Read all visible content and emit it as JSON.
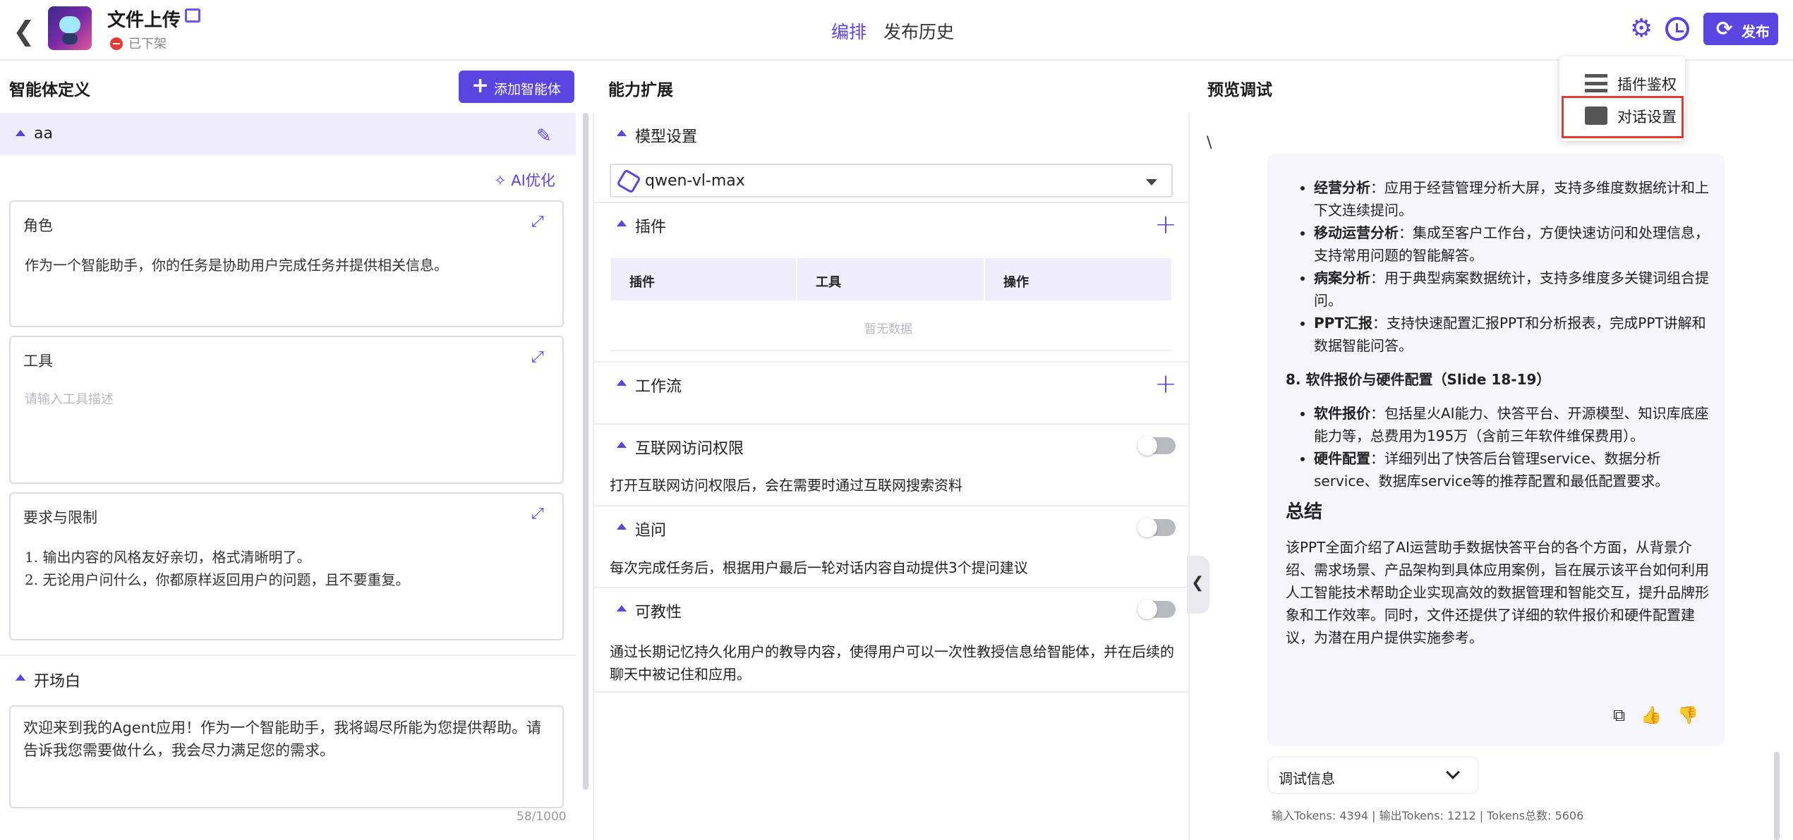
{
  "header": {
    "back_icon": "chevron-left-icon",
    "title": "文件上传",
    "status": "已下架",
    "tabs": [
      {
        "label": "编排",
        "active": true
      },
      {
        "label": "发布历史",
        "active": false
      }
    ],
    "publish_label": "发布"
  },
  "menu": {
    "items": [
      {
        "label": "插件鉴权",
        "icon": "list-icon"
      },
      {
        "label": "对话设置",
        "icon": "chat-icon",
        "highlighted": true
      }
    ]
  },
  "left": {
    "heading": "智能体定义",
    "add_label": "添加智能体",
    "agent_name": "aa",
    "ai_optimize": "AI优化",
    "role": {
      "label": "角色",
      "text": "作为一个智能助手，你的任务是协助用户完成任务并提供相关信息。"
    },
    "tools": {
      "label": "工具",
      "placeholder": "请输入工具描述"
    },
    "requirements": {
      "label": "要求与限制",
      "lines": [
        "1.  输出内容的风格友好亲切，格式清晰明了。",
        "2.  无论用户问什么，你都原样返回用户的问题，且不要重复。"
      ]
    },
    "opening": {
      "label": "开场白",
      "text": "欢迎来到我的Agent应用！作为一个智能助手，我将竭尽所能为您提供帮助。请告诉我您需要做什么，我会尽力满足您的需求。",
      "count": "58/1000"
    }
  },
  "middle": {
    "heading": "能力扩展",
    "model_section": "模型设置",
    "model": "qwen-vl-max",
    "plugin_section": "插件",
    "table_headers": [
      "插件",
      "工具",
      "操作"
    ],
    "no_data": "暂无数据",
    "workflow_section": "工作流",
    "internet": {
      "label": "互联网访问权限",
      "desc": "打开互联网访问权限后，会在需要时通过互联网搜索资料",
      "on": false
    },
    "followup": {
      "label": "追问",
      "desc": "每次完成任务后，根据用户最后一轮对话内容自动提供3个提问建议",
      "on": false
    },
    "teachable": {
      "label": "可教性",
      "desc": "通过长期记忆持久化用户的教导内容，使得用户可以一次性教授信息给智能体，并在后续的聊天中被记住和应用。",
      "on": false
    }
  },
  "right": {
    "heading": "预览调试",
    "backslash": "\\",
    "bullets1": [
      {
        "bold": "经营分析",
        "text": "：应用于经营管理分析大屏，支持多维度数据统计和上下文连续提问。"
      },
      {
        "bold": "移动运营分析",
        "text": "：集成至客户工作台，方便快速访问和处理信息，支持常用问题的智能解答。"
      },
      {
        "bold": "病案分析",
        "text": "：用于典型病案数据统计，支持多维度多关键词组合提问。"
      },
      {
        "bold": "PPT汇报",
        "text": "：支持快速配置汇报PPT和分析报表，完成PPT讲解和数据智能问答。"
      }
    ],
    "section8": "8. 软件报价与硬件配置（Slide 18-19）",
    "bullets2": [
      {
        "bold": "软件报价",
        "text": "：包括星火AI能力、快答平台、开源模型、知识库底座能力等，总费用为195万（含前三年软件维保费用）。"
      },
      {
        "bold": "硬件配置",
        "text": "：详细列出了快答后台管理service、数据分析service、数据库service等的推荐配置和最低配置要求。"
      }
    ],
    "summary_title": "总结",
    "summary": "该PPT全面介绍了AI运营助手数据快答平台的各个方面，从背景介绍、需求场景、产品架构到具体应用案例，旨在展示该平台如何利用人工智能技术帮助企业实现高效的数据管理和智能交互，提升品牌形象和工作效率。同时，文件还提供了详细的软件报价和硬件配置建议，为潜在用户提供实施参考。",
    "debug_label": "调试信息",
    "tokens": "输入Tokens: 4394 |   输出Tokens: 1212 |   Tokens总数: 5606"
  }
}
